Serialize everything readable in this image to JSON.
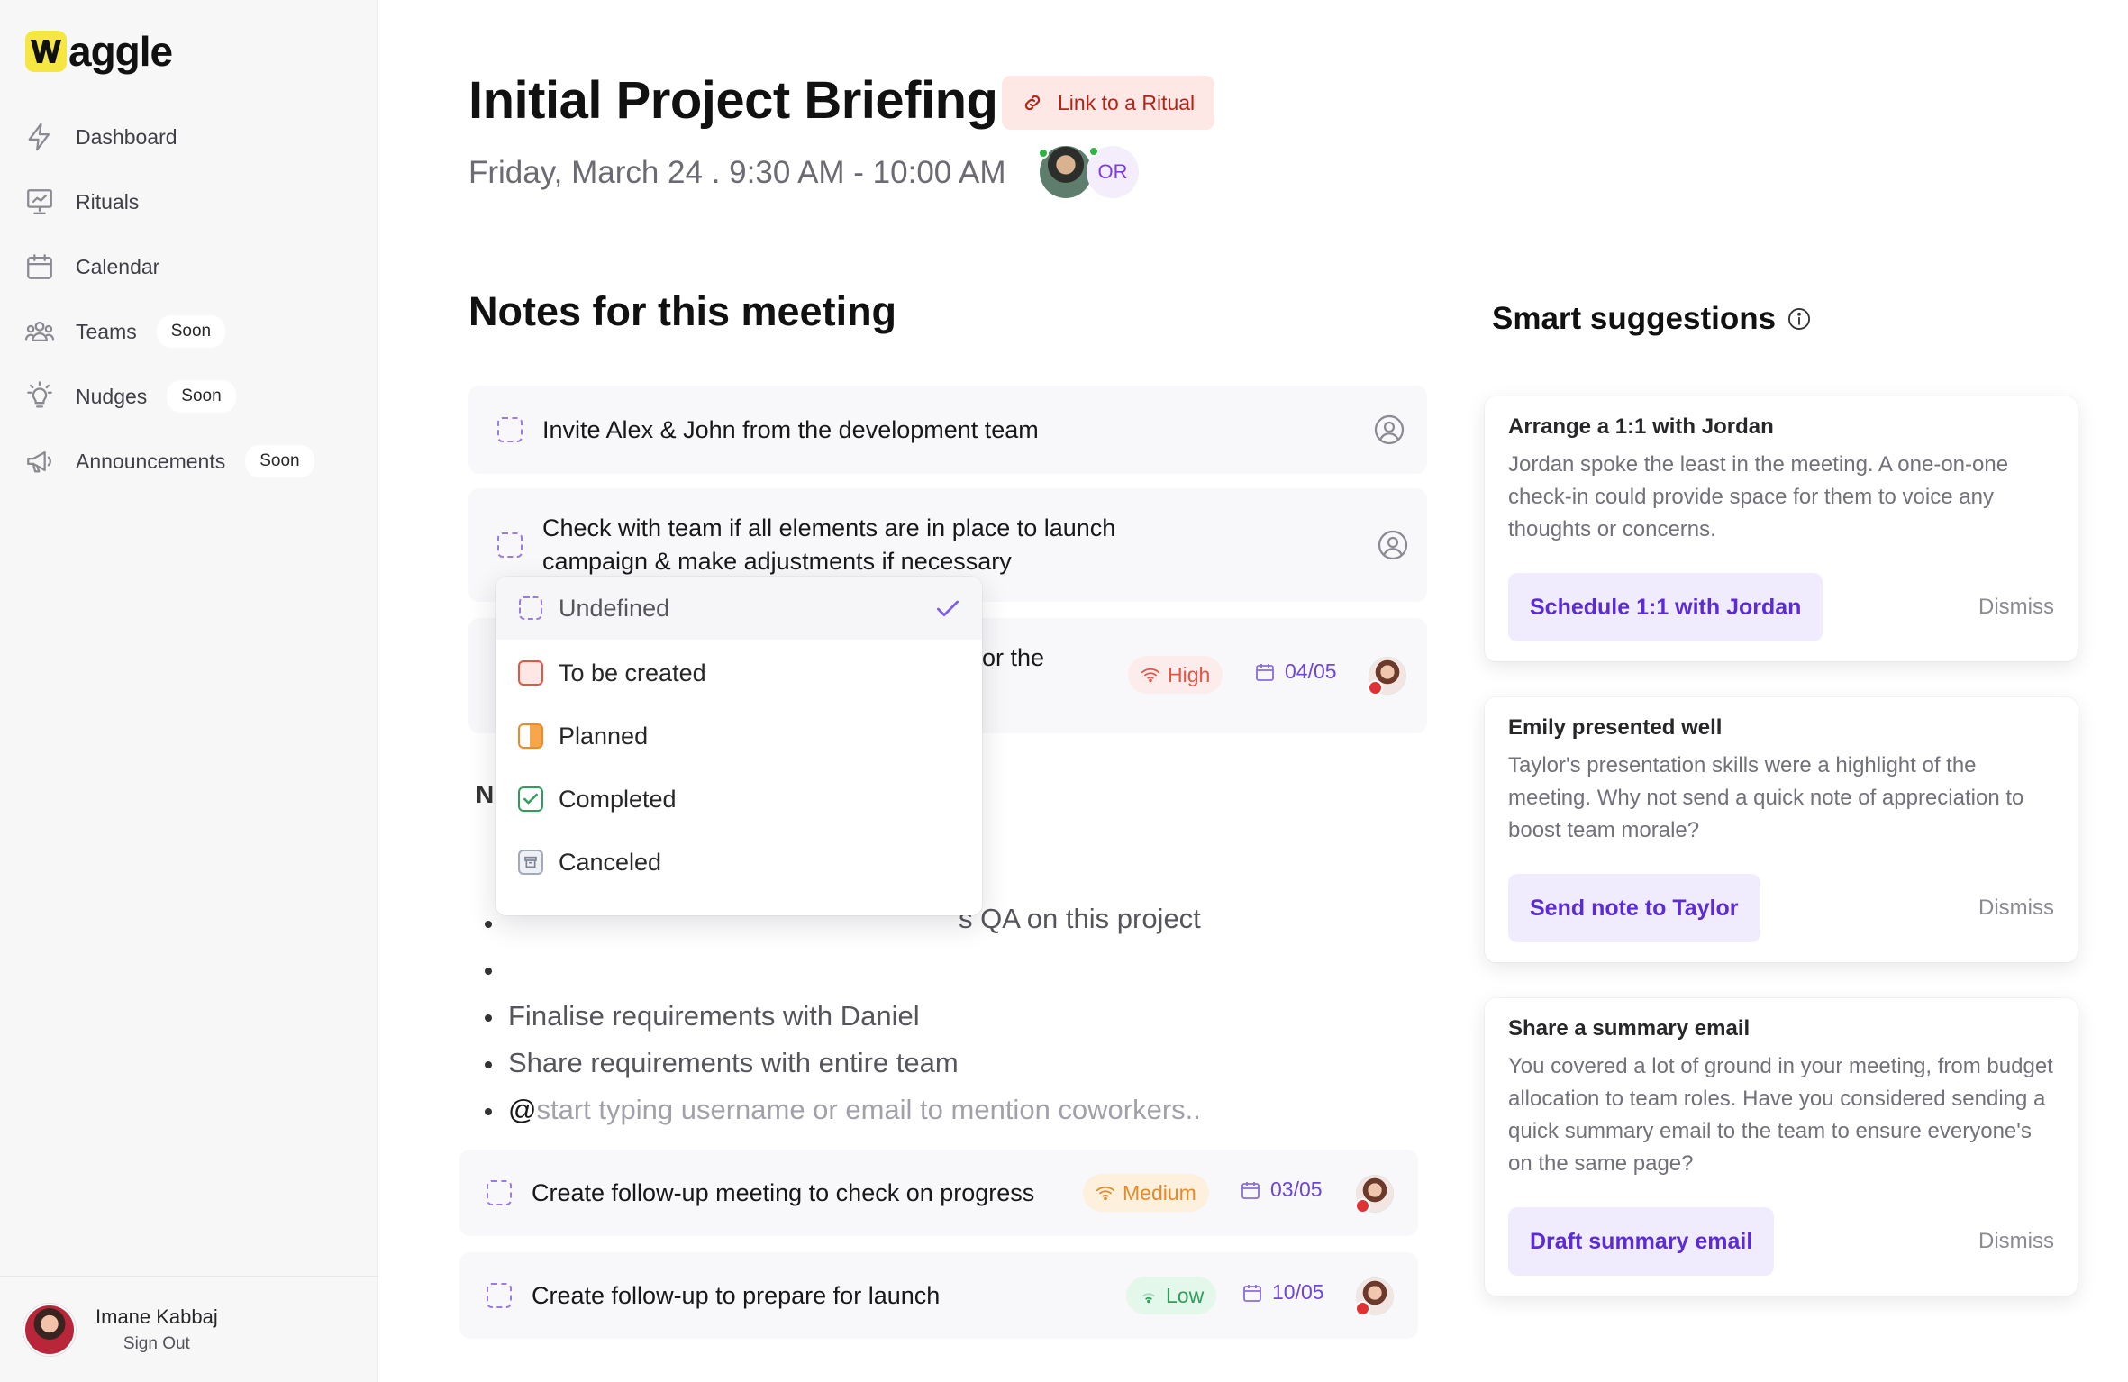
{
  "app": {
    "name": "Waggle"
  },
  "sidebar": {
    "items": [
      {
        "label": "Dashboard",
        "icon": "lightning-icon"
      },
      {
        "label": "Rituals",
        "icon": "presentation-chart-icon"
      },
      {
        "label": "Calendar",
        "icon": "calendar-icon"
      },
      {
        "label": "Teams",
        "icon": "users-icon",
        "badge": "Soon"
      },
      {
        "label": "Nudges",
        "icon": "lightbulb-icon",
        "badge": "Soon"
      },
      {
        "label": "Announcements",
        "icon": "megaphone-icon",
        "badge": "Soon"
      }
    ],
    "user": {
      "name": "Imane Kabbaj",
      "signout": "Sign Out"
    }
  },
  "meeting": {
    "title": "Initial Project Briefing",
    "ritual_button": "Link to a Ritual",
    "datetime": "Friday, March 24 . 9:30 AM - 10:00 AM",
    "attendee_initials": "OR"
  },
  "notes": {
    "section_title": "Notes for this meeting",
    "tasks": [
      {
        "text": "Invite Alex & John from the development team"
      },
      {
        "text": "Check with team if all elements are in place to launch campaign & make adjustments if necessary"
      },
      {
        "text_fragment": "or the",
        "priority": "High",
        "due": "04/05"
      },
      {
        "text": "Create follow-up meeting to check on progress",
        "priority": "Medium",
        "due": "03/05"
      },
      {
        "text": "Create follow-up to prepare for launch",
        "priority": "Low",
        "due": "10/05"
      }
    ],
    "subheading_fragment": "N",
    "bullets": [
      "s QA on this project",
      "Finalise requirements with Daniel",
      "Share requirements with entire team"
    ],
    "mention_prefix": "@",
    "mention_placeholder": "start typing username or email to mention coworkers.."
  },
  "status_dropdown": {
    "selected": "Undefined",
    "options": [
      "Undefined",
      "To be created",
      "Planned",
      "Completed",
      "Canceled"
    ]
  },
  "smart_suggestions": {
    "title": "Smart suggestions",
    "cards": [
      {
        "title": "Arrange a 1:1 with Jordan",
        "body": "Jordan spoke the least in the meeting. A one-on-one check-in could provide space for them to voice any thoughts or concerns.",
        "action": "Schedule 1:1 with Jordan",
        "dismiss": "Dismiss"
      },
      {
        "title": "Emily presented well",
        "body": "Taylor's presentation skills were a highlight of the meeting. Why not send a quick note of appreciation to boost team morale?",
        "action": "Send note to Taylor",
        "dismiss": "Dismiss"
      },
      {
        "title": "Share a summary email",
        "body": "You covered a lot of ground in your meeting, from budget allocation to team roles. Have you considered sending a quick summary email to the team to ensure everyone's on the same page?",
        "action": "Draft summary email",
        "dismiss": "Dismiss"
      }
    ]
  },
  "colors": {
    "accent": "#6d45d8",
    "priority_high": "#e25547",
    "priority_medium": "#e4892c",
    "priority_low": "#2f9e5a",
    "logo_yellow": "#f5e642"
  }
}
